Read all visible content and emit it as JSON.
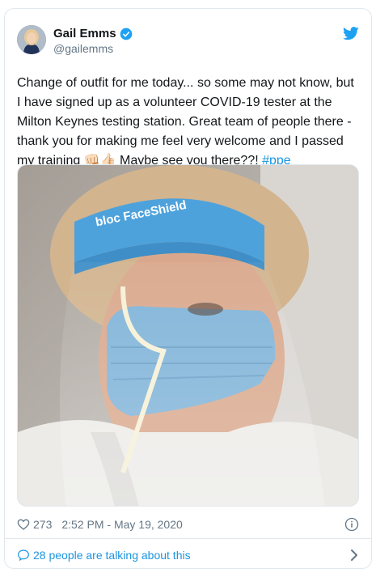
{
  "tweet": {
    "author_name": "Gail Emms",
    "author_handle": "@gailemms",
    "text_main": "Change of outfit for me today... so some may not know, but I have signed up as a volunteer COVID-19 tester at the Milton Keynes testing station. Great team of people there - thank you for making me feel very welcome and I passed my training ",
    "emoji": "👊🏻👍🏻",
    "text_end": " Maybe see you there??! ",
    "hashtag": "#ppe",
    "likes": "273",
    "timestamp": "2:52 PM - May 19, 2020",
    "talking_label": "28 people are talking about this",
    "shield_brand": "bloc FaceShield"
  },
  "colors": {
    "link": "#1b95e0",
    "text": "#14171a",
    "secondary": "#657786",
    "verified": "#1da1f2"
  },
  "icons": [
    "verified-badge-icon",
    "twitter-bird-icon",
    "heart-icon",
    "info-icon",
    "speech-bubble-icon",
    "chevron-right-icon"
  ]
}
